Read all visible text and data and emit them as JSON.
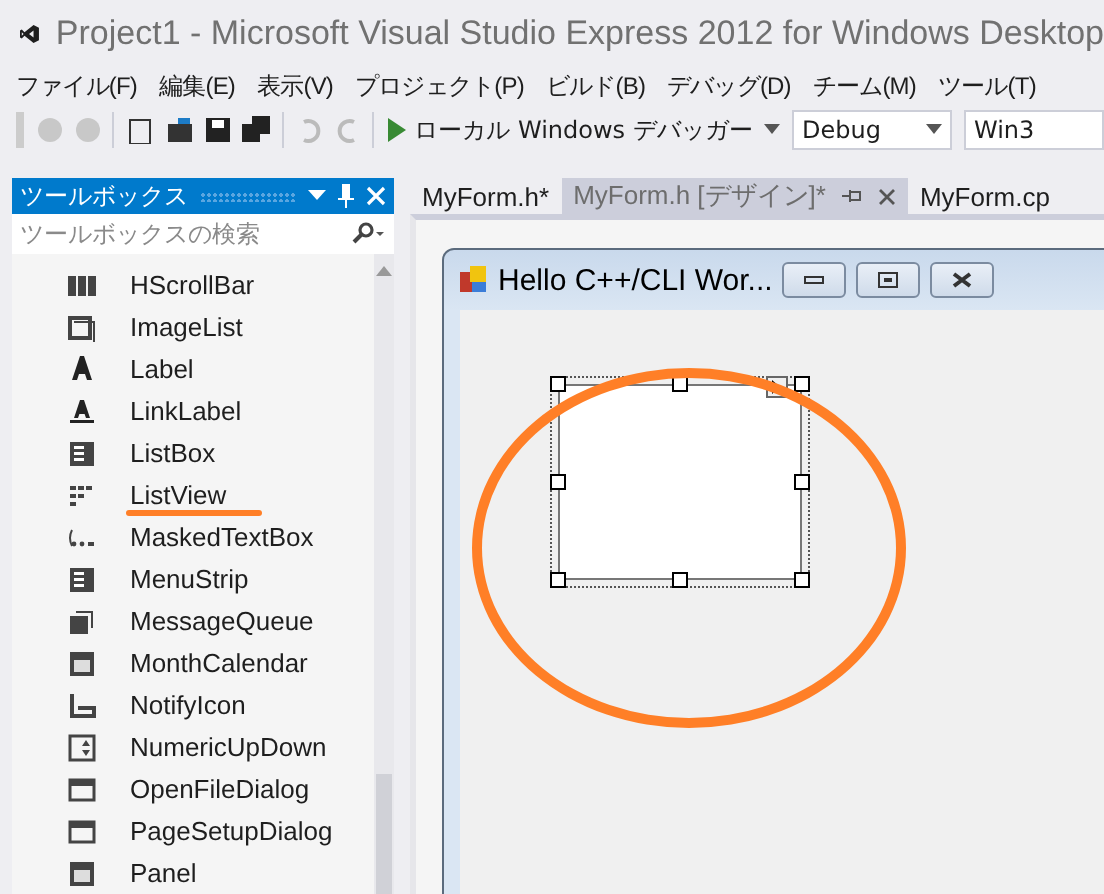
{
  "window": {
    "title": "Project1 - Microsoft Visual Studio Express 2012 for Windows Desktop"
  },
  "menu": [
    "ファイル(F)",
    "編集(E)",
    "表示(V)",
    "プロジェクト(P)",
    "ビルド(B)",
    "デバッグ(D)",
    "チーム(M)",
    "ツール(T)"
  ],
  "toolbar": {
    "debugger": "ローカル Windows デバッガー",
    "configuration": "Debug",
    "platform": "Win3"
  },
  "toolbox": {
    "title": "ツールボックス",
    "search": {
      "placeholder": "ツールボックスの検索"
    },
    "items": [
      {
        "label": "HScrollBar",
        "kind": "bar",
        "annotated": false
      },
      {
        "label": "ImageList",
        "kind": "picture",
        "annotated": false
      },
      {
        "label": "Label",
        "kind": "letter",
        "annotated": false
      },
      {
        "label": "LinkLabel",
        "kind": "link",
        "annotated": false
      },
      {
        "label": "ListBox",
        "kind": "list",
        "annotated": false
      },
      {
        "label": "ListView",
        "kind": "grid",
        "annotated": true
      },
      {
        "label": "MaskedTextBox",
        "kind": "mask",
        "annotated": false
      },
      {
        "label": "MenuStrip",
        "kind": "list",
        "annotated": false
      },
      {
        "label": "MessageQueue",
        "kind": "stack",
        "annotated": false
      },
      {
        "label": "MonthCalendar",
        "kind": "calendar",
        "annotated": false
      },
      {
        "label": "NotifyIcon",
        "kind": "corner",
        "annotated": false
      },
      {
        "label": "NumericUpDown",
        "kind": "spinner",
        "annotated": false
      },
      {
        "label": "OpenFileDialog",
        "kind": "dialog",
        "annotated": false
      },
      {
        "label": "PageSetupDialog",
        "kind": "dialog",
        "annotated": false
      },
      {
        "label": "Panel",
        "kind": "calendar",
        "annotated": false
      }
    ]
  },
  "tabs": [
    {
      "label": "MyForm.h*",
      "selected": false
    },
    {
      "label": "MyForm.h [デザイン]*",
      "selected": true
    },
    {
      "label": "MyForm.cp",
      "selected": false
    }
  ],
  "form": {
    "title": "Hello C++/CLI Wor...",
    "control_selected": true,
    "circled": true
  }
}
